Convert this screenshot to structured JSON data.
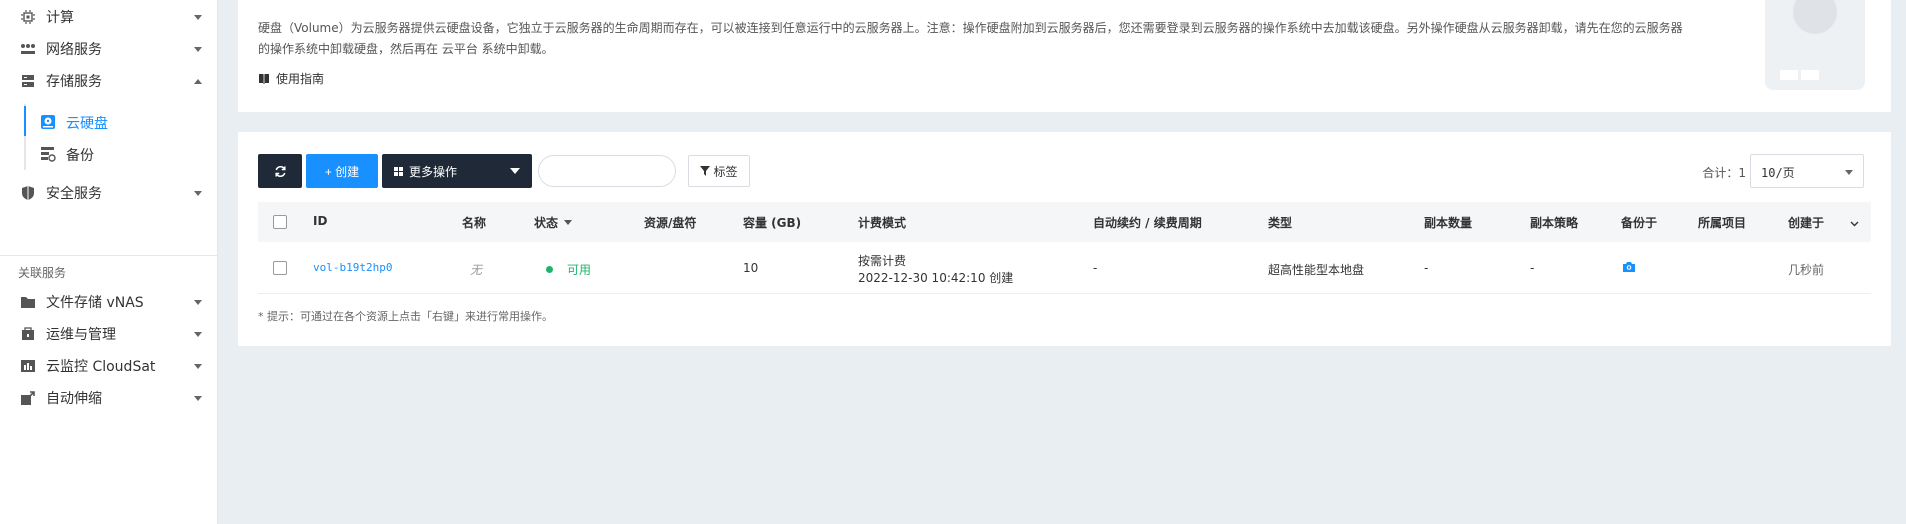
{
  "sidebar": {
    "items": [
      {
        "label": "计算"
      },
      {
        "label": "网络服务"
      },
      {
        "label": "存储服务"
      },
      {
        "label": "安全服务"
      }
    ],
    "sub_items": [
      {
        "label": "云硬盘"
      },
      {
        "label": "备份"
      }
    ],
    "section_title": "关联服务",
    "related": [
      {
        "label": "文件存储 vNAS"
      },
      {
        "label": "运维与管理"
      },
      {
        "label": "云监控 CloudSat"
      },
      {
        "label": "自动伸缩"
      }
    ]
  },
  "intro": {
    "description_line1": "硬盘（Volume）为云服务器提供云硬盘设备，它独立于云服务器的生命周期而存在，可以被连接到任意运行中的云服务器上。注意：操作硬盘附加到云服务器后，您还需要登录到云服务器的操作系统中去加载该硬盘。另外操作硬盘从云服务器卸载，请先在您的云服务器",
    "description_line2": "的操作系统中卸载硬盘，然后再在 云平台 系统中卸载。",
    "guide_label": "使用指南"
  },
  "toolbar": {
    "create_label": "+ 创建",
    "more_label": "更多操作",
    "tag_label": "标签",
    "search_placeholder": "",
    "total_label": "合计：1",
    "page_size": "10/页"
  },
  "table": {
    "columns": [
      "ID",
      "名称",
      "状态",
      "资源/盘符",
      "容量 (GB)",
      "计费模式",
      "自动续约 / 续费周期",
      "类型",
      "副本数量",
      "副本策略",
      "备份于",
      "所属项目",
      "创建于"
    ],
    "rows": [
      {
        "id": "vol-b19t2hp0",
        "name": "无",
        "status": "可用",
        "resource": "",
        "capacity": "10",
        "billing_mode": "按需计费",
        "billing_time": "2022-12-30 10:42:10 创建",
        "auto_renew": "-",
        "type": "超高性能型本地盘",
        "replica_count": "-",
        "replica_policy": "-",
        "project": "",
        "created": "几秒前"
      }
    ]
  },
  "hint": "* 提示：可通过在各个资源上点击「右键」来进行常用操作。",
  "colors": {
    "accent": "#1890ff",
    "dark_button": "#1f2937",
    "status_ok": "#21b36c"
  }
}
